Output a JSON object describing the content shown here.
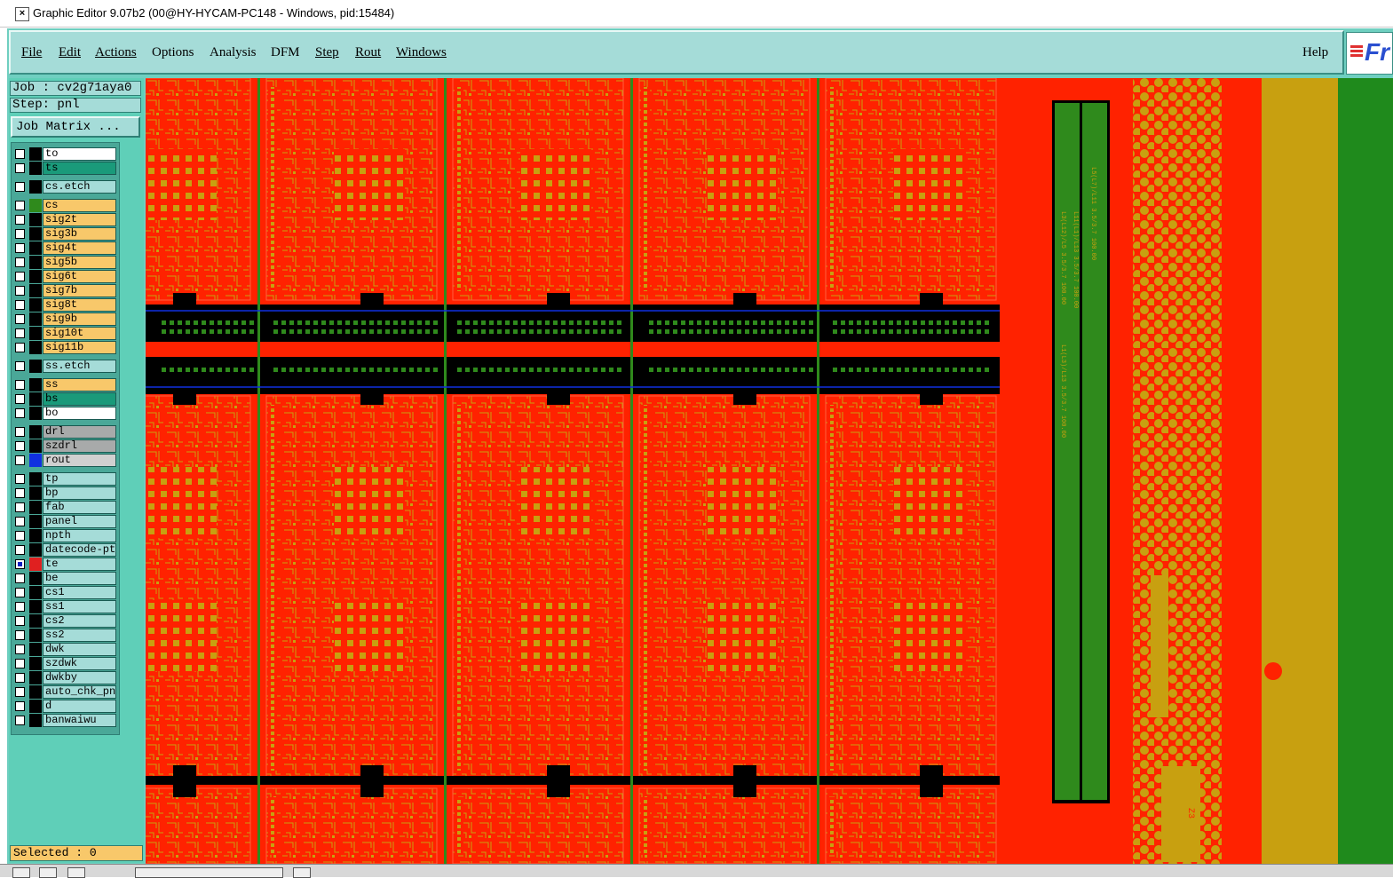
{
  "window": {
    "title": "Graphic Editor 9.07b2 (00@HY-HYCAM-PC148 - Windows, pid:15484)"
  },
  "menubar": {
    "items": [
      "File",
      "Edit",
      "Actions",
      "Options",
      "Analysis",
      "DFM",
      "Step",
      "Rout",
      "Windows"
    ],
    "help": "Help",
    "logo_text": "Fr"
  },
  "info": {
    "job": "Job : cv2g71aya0",
    "step": "Step: pnl",
    "job_matrix_button": "Job Matrix ..."
  },
  "layers": [
    {
      "name": "to",
      "color": "#ffffff",
      "swatch": "#000000",
      "active": false
    },
    {
      "name": "ts",
      "color": "#1a9a7a",
      "swatch": "#000000",
      "active": false
    },
    {
      "name": "cs.etch",
      "color": "#a5dcd8",
      "swatch": "#000000",
      "active": false
    },
    {
      "name": "cs",
      "color": "#f8c86a",
      "swatch": "#2f8a1c",
      "active": false
    },
    {
      "name": "sig2t",
      "color": "#f8c86a",
      "swatch": "#000000",
      "active": false
    },
    {
      "name": "sig3b",
      "color": "#f8c86a",
      "swatch": "#000000",
      "active": false
    },
    {
      "name": "sig4t",
      "color": "#f8c86a",
      "swatch": "#000000",
      "active": false
    },
    {
      "name": "sig5b",
      "color": "#f8c86a",
      "swatch": "#000000",
      "active": false
    },
    {
      "name": "sig6t",
      "color": "#f8c86a",
      "swatch": "#000000",
      "active": false
    },
    {
      "name": "sig7b",
      "color": "#f8c86a",
      "swatch": "#000000",
      "active": false
    },
    {
      "name": "sig8t",
      "color": "#f8c86a",
      "swatch": "#000000",
      "active": false
    },
    {
      "name": "sig9b",
      "color": "#f8c86a",
      "swatch": "#000000",
      "active": false
    },
    {
      "name": "sig10t",
      "color": "#f8c86a",
      "swatch": "#000000",
      "active": false
    },
    {
      "name": "sig11b",
      "color": "#f8c86a",
      "swatch": "#000000",
      "active": false
    },
    {
      "name": "ss.etch",
      "color": "#a5dcd8",
      "swatch": "#000000",
      "active": false
    },
    {
      "name": "ss",
      "color": "#f8c86a",
      "swatch": "#000000",
      "active": false
    },
    {
      "name": "bs",
      "color": "#1a9a7a",
      "swatch": "#000000",
      "active": false
    },
    {
      "name": "bo",
      "color": "#ffffff",
      "swatch": "#000000",
      "active": false
    },
    {
      "name": "drl",
      "color": "#a8aaaa",
      "swatch": "#000000",
      "active": false
    },
    {
      "name": "szdrl",
      "color": "#a8aaaa",
      "swatch": "#000000",
      "active": false
    },
    {
      "name": "rout",
      "color": "#d0d0d0",
      "swatch": "#1030e0",
      "active": false
    },
    {
      "name": "tp",
      "color": "#a5dcd8",
      "swatch": "#000000",
      "active": false
    },
    {
      "name": "bp",
      "color": "#a5dcd8",
      "swatch": "#000000",
      "active": false
    },
    {
      "name": "fab",
      "color": "#a5dcd8",
      "swatch": "#000000",
      "active": false
    },
    {
      "name": "panel",
      "color": "#a5dcd8",
      "swatch": "#000000",
      "active": false
    },
    {
      "name": "npth",
      "color": "#a5dcd8",
      "swatch": "#000000",
      "active": false
    },
    {
      "name": "datecode-pte",
      "color": "#a5dcd8",
      "swatch": "#000000",
      "active": false
    },
    {
      "name": "te",
      "color": "#a5dcd8",
      "swatch": "#e02020",
      "active": true
    },
    {
      "name": "be",
      "color": "#a5dcd8",
      "swatch": "#000000",
      "active": false
    },
    {
      "name": "cs1",
      "color": "#a5dcd8",
      "swatch": "#000000",
      "active": false
    },
    {
      "name": "ss1",
      "color": "#a5dcd8",
      "swatch": "#000000",
      "active": false
    },
    {
      "name": "cs2",
      "color": "#a5dcd8",
      "swatch": "#000000",
      "active": false
    },
    {
      "name": "ss2",
      "color": "#a5dcd8",
      "swatch": "#000000",
      "active": false
    },
    {
      "name": "dwk",
      "color": "#a5dcd8",
      "swatch": "#000000",
      "active": false
    },
    {
      "name": "szdwk",
      "color": "#a5dcd8",
      "swatch": "#000000",
      "active": false
    },
    {
      "name": "dwkby",
      "color": "#a5dcd8",
      "swatch": "#000000",
      "active": false
    },
    {
      "name": "auto_chk_pnl",
      "color": "#a5dcd8",
      "swatch": "#000000",
      "active": false
    },
    {
      "name": "d",
      "color": "#a5dcd8",
      "swatch": "#000000",
      "active": false
    },
    {
      "name": "banwaiwu",
      "color": "#a5dcd8",
      "swatch": "#000000",
      "active": false
    }
  ],
  "status": {
    "selected": "Selected : 0"
  },
  "canvas": {
    "colors": {
      "copper": "#ff2200",
      "feature": "#c8a010",
      "outline": "#000000",
      "green": "#2f8a1c",
      "blue": "#1030e0"
    },
    "vertical_labels": [
      "L3(L12)/L5 3.5/3.7 100.00",
      "L11(L1)/L13 3.5/3.7 100.00",
      "L1(L3)/L13 3.5/3.7 100.00",
      "L5(L7)/L11 3.5/3.7 100.00"
    ],
    "coupon_label": "Z3"
  }
}
